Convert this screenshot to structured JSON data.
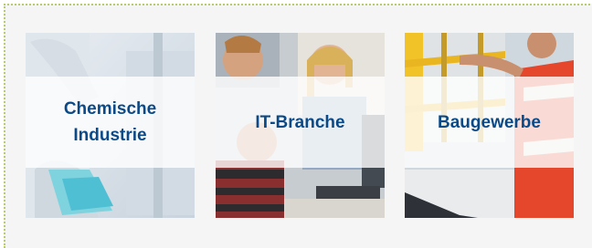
{
  "tiles": [
    {
      "label": "Chemische\nIndustrie",
      "icon": "chemistry-lab-photo"
    },
    {
      "label": "IT-Branche",
      "icon": "it-team-photo"
    },
    {
      "label": "Baugewerbe",
      "icon": "construction-site-photo"
    }
  ],
  "colors": {
    "label": "#0c4a87",
    "frame_border": "#b7cc6a",
    "background": "#f5f5f5"
  }
}
